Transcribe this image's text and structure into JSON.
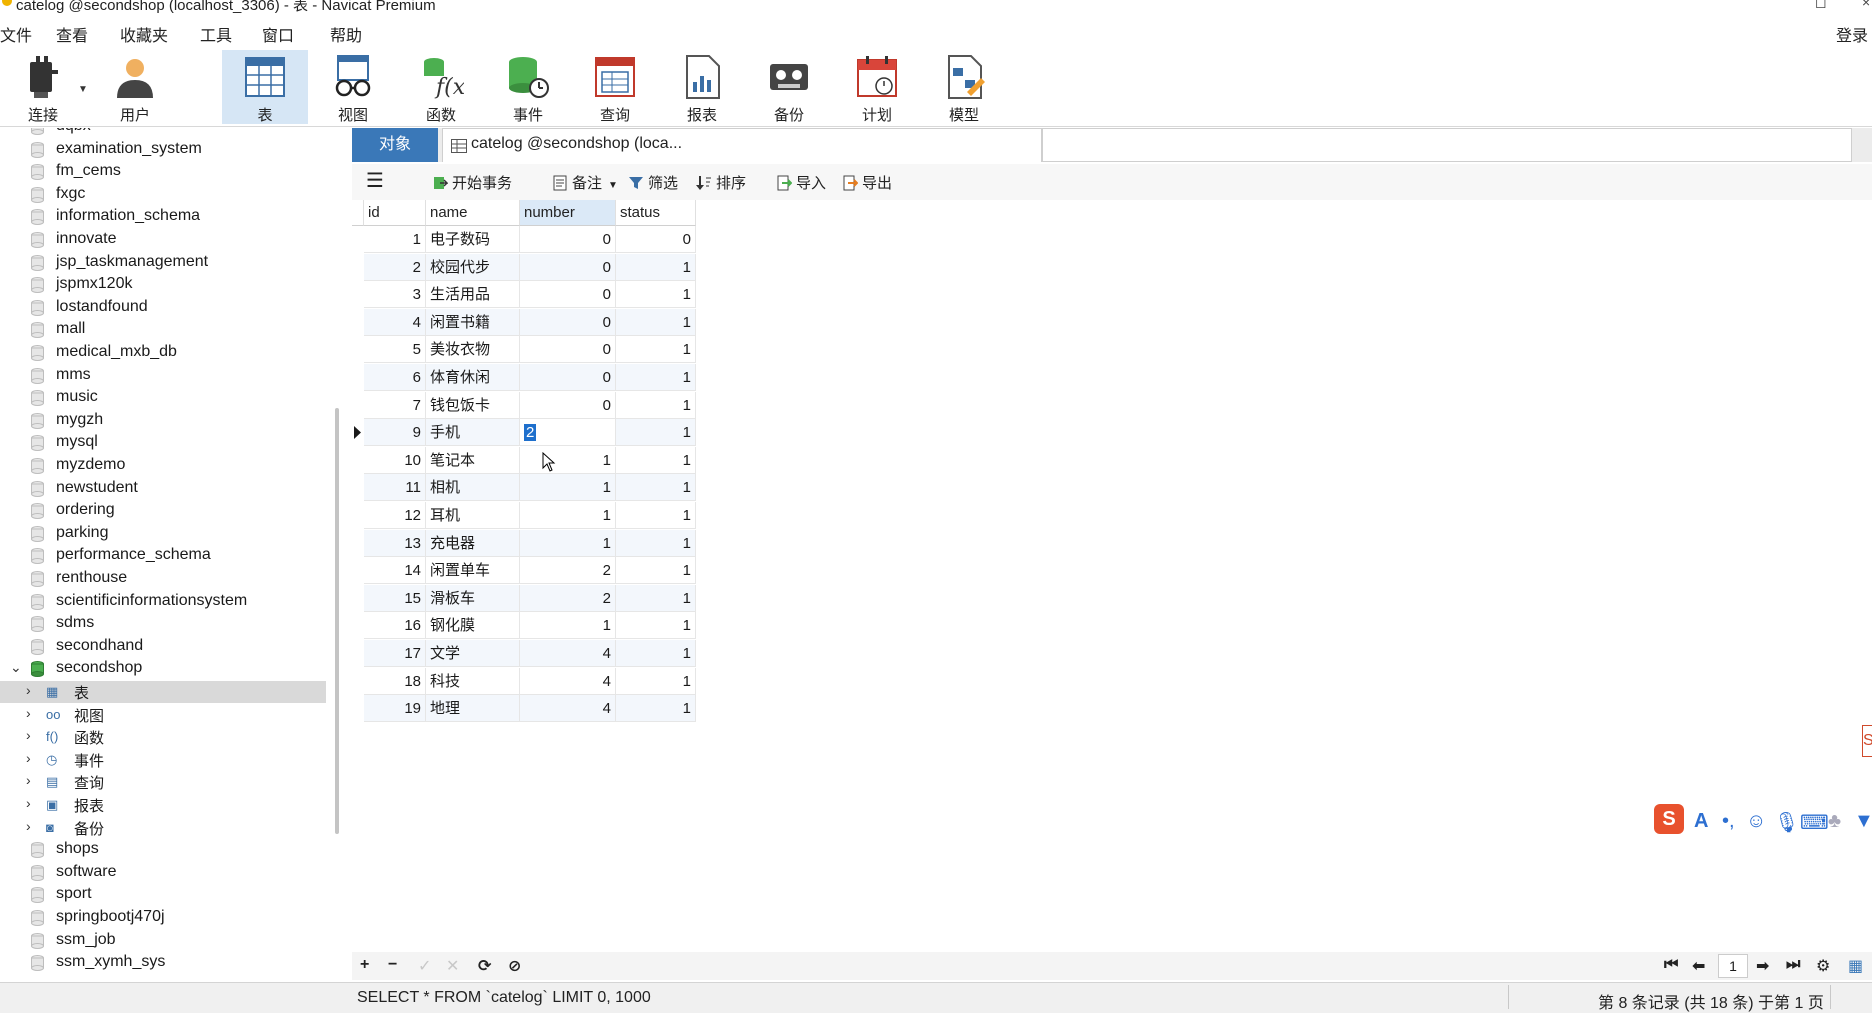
{
  "window": {
    "title": "catelog @secondshop (localhost_3306) - 表 - Navicat Premium",
    "buttons": [
      "◻",
      "×"
    ]
  },
  "menu": {
    "items": [
      "文件",
      "查看",
      "收藏夹",
      "工具",
      "窗口",
      "帮助"
    ],
    "login": "登录"
  },
  "toolbar": {
    "items": [
      "连接",
      "用户",
      "表",
      "视图",
      "函数",
      "事件",
      "查询",
      "报表",
      "备份",
      "计划",
      "模型"
    ]
  },
  "sidebar": {
    "databases_top": [
      "dqbx",
      "examination_system",
      "fm_cems",
      "fxgc",
      "information_schema",
      "innovate",
      "jsp_taskmanagement",
      "jspmx120k",
      "lostandfound",
      "mall",
      "medical_mxb_db",
      "mms",
      "music",
      "mygzh",
      "mysql",
      "myzdemo",
      "newstudent",
      "ordering",
      "parking",
      "performance_schema",
      "renthouse",
      "scientificinformationsystem",
      "sdms",
      "secondhand"
    ],
    "expanded_db": "secondshop",
    "children": [
      "表",
      "视图",
      "函数",
      "事件",
      "查询",
      "报表",
      "备份"
    ],
    "databases_bottom": [
      "shops",
      "software",
      "sport",
      "springbootj470j",
      "ssm_job",
      "ssm_xymh_sys"
    ]
  },
  "tabs": {
    "objects": "对象",
    "document": "catelog @secondshop (loca..."
  },
  "subtoolbar": {
    "begin_tx": "开始事务",
    "note": "备注",
    "filter": "筛选",
    "sort": "排序",
    "import": "导入",
    "export": "导出",
    "menu_glyph": "☰"
  },
  "table": {
    "columns": [
      "id",
      "name",
      "number",
      "status"
    ],
    "rows": [
      [
        "1",
        "电子数码",
        "0",
        "0"
      ],
      [
        "2",
        "校园代步",
        "0",
        "1"
      ],
      [
        "3",
        "生活用品",
        "0",
        "1"
      ],
      [
        "4",
        "闲置书籍",
        "0",
        "1"
      ],
      [
        "5",
        "美妆衣物",
        "0",
        "1"
      ],
      [
        "6",
        "体育休闲",
        "0",
        "1"
      ],
      [
        "7",
        "钱包饭卡",
        "0",
        "1"
      ],
      [
        "9",
        "手机",
        "2",
        "1"
      ],
      [
        "10",
        "笔记本",
        "1",
        "1"
      ],
      [
        "11",
        "相机",
        "1",
        "1"
      ],
      [
        "12",
        "耳机",
        "1",
        "1"
      ],
      [
        "13",
        "充电器",
        "1",
        "1"
      ],
      [
        "14",
        "闲置单车",
        "2",
        "1"
      ],
      [
        "15",
        "滑板车",
        "2",
        "1"
      ],
      [
        "16",
        "钢化膜",
        "1",
        "1"
      ],
      [
        "17",
        "文学",
        "4",
        "1"
      ],
      [
        "18",
        "科技",
        "4",
        "1"
      ],
      [
        "19",
        "地理",
        "4",
        "1"
      ]
    ]
  },
  "bottom": {
    "add": "+",
    "remove": "−",
    "confirm": "✓",
    "cancel": "✕",
    "refresh": "⟳",
    "stop": "⊘",
    "page": "1"
  },
  "status": {
    "sql": "SELECT * FROM `catelog` LIMIT 0, 1000",
    "records": "第 8 条记录 (共 18 条) 于第 1 页"
  },
  "ime": {
    "logo": "S"
  },
  "colors": {
    "accent": "#3a78b8",
    "selected_tab": "#d6e6f5",
    "edit_highlight": "#1e6fcc"
  }
}
